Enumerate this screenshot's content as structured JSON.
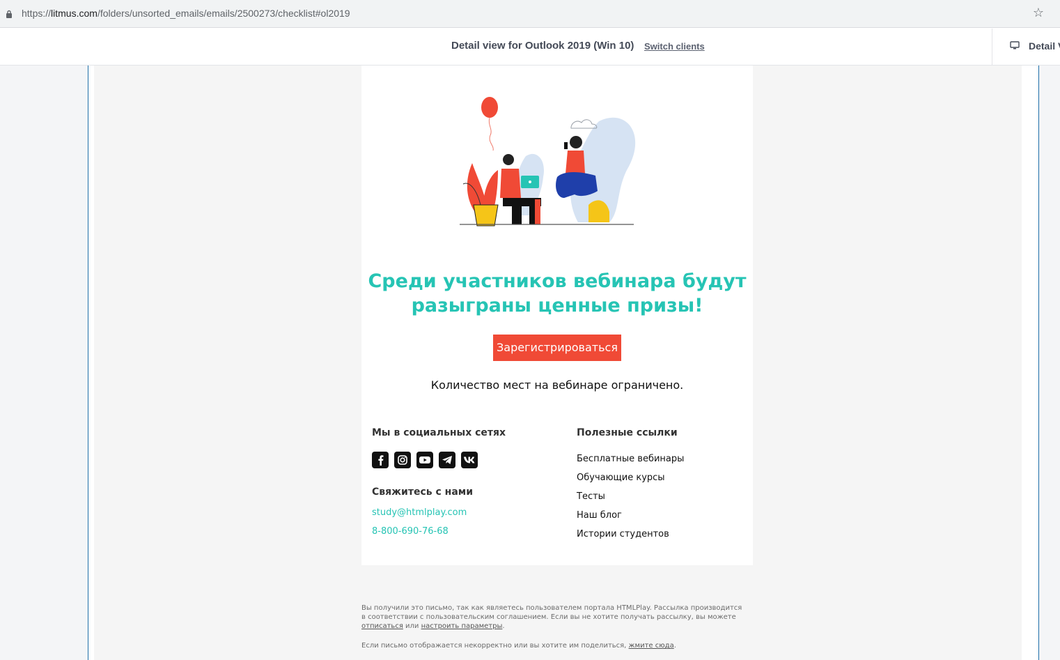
{
  "browser": {
    "url_prefix": "https://",
    "url_host": "litmus.com",
    "url_path": "/folders/unsorted_emails/emails/2500273/checklist#ol2019"
  },
  "litmus": {
    "detail_title": "Detail view for Outlook 2019 (Win 10)",
    "switch_clients": "Switch clients",
    "detail_view_right": "Detail V"
  },
  "email": {
    "headline_line1": "Среди участников вебинара будут",
    "headline_line2": "разыграны ценные призы!",
    "cta_label": "Зарегистрироваться",
    "limit_note": "Количество мест на вебинаре ограничено.",
    "social": {
      "title": "Мы в социальных сетях",
      "networks": [
        "facebook",
        "instagram",
        "youtube",
        "telegram",
        "vk"
      ]
    },
    "contact": {
      "title": "Свяжитесь с нами",
      "email": "study@htmlplay.com",
      "phone": "8-800-690-76-68"
    },
    "useful": {
      "title": "Полезные ссылки",
      "links": [
        "Бесплатные вебинары",
        "Обучающие курсы",
        "Тесты",
        "Наш блог",
        "Истории студентов"
      ]
    },
    "colors": {
      "accent": "#26c4b4",
      "cta": "#f04a36"
    }
  },
  "footer": {
    "notice_line1": "Вы получили это письмо, так как являетесь пользователем портала HTMLPlay. Рассылка производится",
    "notice_line2": "в соответствии с пользовательским соглашением. Если вы не хотите получать рассылку, вы можете",
    "unsubscribe": "отписаться",
    "or": " или ",
    "settings": "настроить параметры",
    "period": ".",
    "share_text": "Если письмо отображается некорректно или вы хотите им поделиться, ",
    "share_link": "жмите сюда",
    "share_end": "."
  }
}
